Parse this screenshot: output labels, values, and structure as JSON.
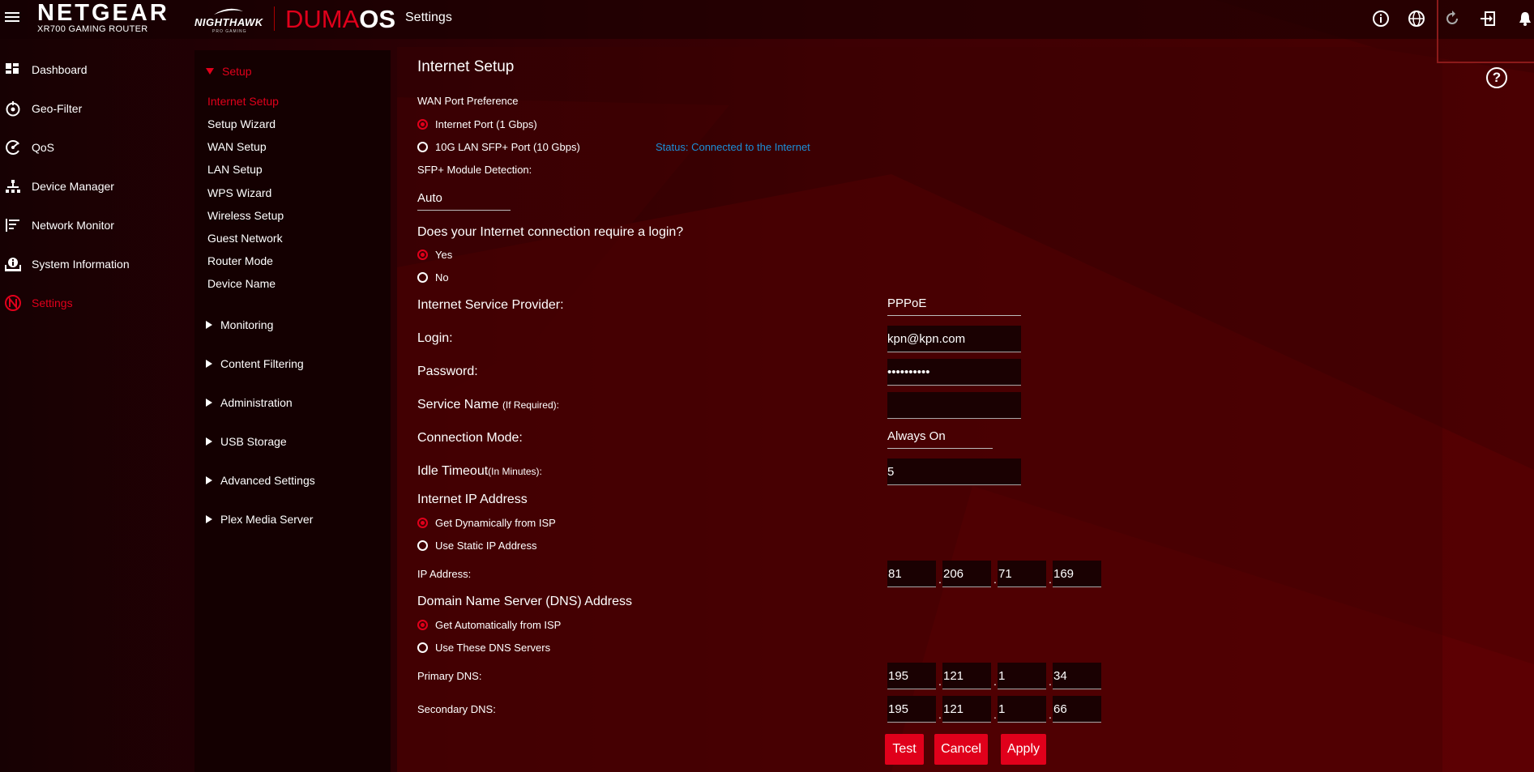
{
  "header": {
    "brand": "NETGEAR",
    "model": "XR700 GAMING ROUTER",
    "nighthawk": "NIGHTHAWK",
    "nighthawk_sub": "PRO GAMING",
    "duma_1": "DUMA",
    "duma_2": "OS",
    "page": "Settings",
    "icons": [
      "info-icon",
      "globe-icon",
      "refresh-icon",
      "logout-icon",
      "bell-icon"
    ],
    "help": "?"
  },
  "leftnav": [
    {
      "label": "Dashboard",
      "icon": "dashboard-icon"
    },
    {
      "label": "Geo-Filter",
      "icon": "geo-filter-icon"
    },
    {
      "label": "QoS",
      "icon": "qos-icon"
    },
    {
      "label": "Device Manager",
      "icon": "device-manager-icon"
    },
    {
      "label": "Network Monitor",
      "icon": "network-monitor-icon"
    },
    {
      "label": "System Information",
      "icon": "system-info-icon"
    },
    {
      "label": "Settings",
      "icon": "settings-icon",
      "active": true
    }
  ],
  "submenu": {
    "setup": "Setup",
    "setup_items": [
      "Internet Setup",
      "Setup Wizard",
      "WAN Setup",
      "LAN Setup",
      "WPS Wizard",
      "Wireless Setup",
      "Guest Network",
      "Router Mode",
      "Device Name"
    ],
    "sections": [
      "Monitoring",
      "Content Filtering",
      "Administration",
      "USB Storage",
      "Advanced Settings",
      "Plex Media Server"
    ]
  },
  "form": {
    "title": "Internet Setup",
    "wan_pref_label": "WAN Port Preference",
    "wan_opt1": "Internet Port (1 Gbps)",
    "wan_opt2": "10G LAN SFP+ Port (10 Gbps)",
    "status": "Status: Connected to the Internet",
    "sfp_label": "SFP+ Module Detection:",
    "sfp_value": "Auto",
    "login_q": "Does your Internet connection require a login?",
    "yes": "Yes",
    "no": "No",
    "isp_label": "Internet Service Provider:",
    "isp_value": "PPPoE",
    "login_label": "Login:",
    "login_value": "kpn@kpn.com",
    "password_label": "Password:",
    "password_value": "••••••••••",
    "service_label": "Service Name",
    "service_hint": "(If Required):",
    "service_value": "",
    "conn_mode_label": "Connection Mode:",
    "conn_mode_value": "Always On",
    "idle_label": "Idle Timeout",
    "idle_hint": "(In Minutes):",
    "idle_value": "5",
    "ip_section": "Internet IP Address",
    "ip_opt1": "Get Dynamically from ISP",
    "ip_opt2": "Use Static IP Address",
    "ip_label": "IP Address:",
    "ip": [
      "81",
      "206",
      "71",
      "169"
    ],
    "dns_section": "Domain Name Server (DNS) Address",
    "dns_opt1": "Get Automatically from ISP",
    "dns_opt2": "Use These DNS Servers",
    "primary_label": "Primary DNS:",
    "primary": [
      "195",
      "121",
      "1",
      "34"
    ],
    "secondary_label": "Secondary DNS:",
    "secondary": [
      "195",
      "121",
      "1",
      "66"
    ],
    "btn_test": "Test",
    "btn_cancel": "Cancel",
    "btn_apply": "Apply"
  },
  "colors": {
    "accent": "#e0001b",
    "status_link": "#1c8fd8",
    "panel": "#140001"
  }
}
